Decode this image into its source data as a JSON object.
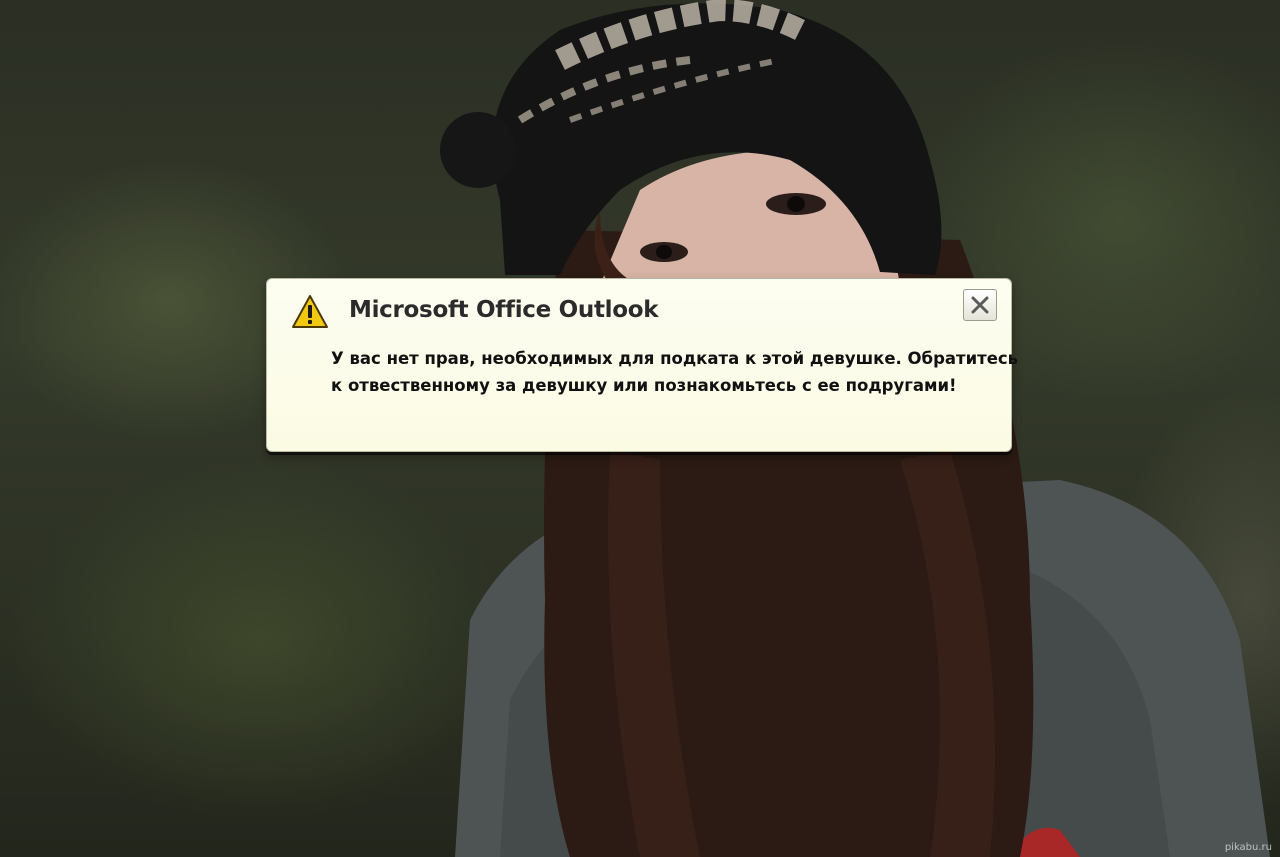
{
  "dialog": {
    "title": "Microsoft Office Outlook",
    "icon": "warning-triangle-icon",
    "close_icon": "close-icon",
    "message_lines": [
      "У вас нет прав, необходимых для подката к этой девушке. Обратитесь",
      "к отвественному за девушку или познакомьтесь с ее подругами!"
    ]
  },
  "watermark": "pikabu.ru",
  "colors": {
    "dialog_background": "#fbfbe4",
    "warning_yellow": "#f2c811",
    "background_green": "#343a2a"
  }
}
